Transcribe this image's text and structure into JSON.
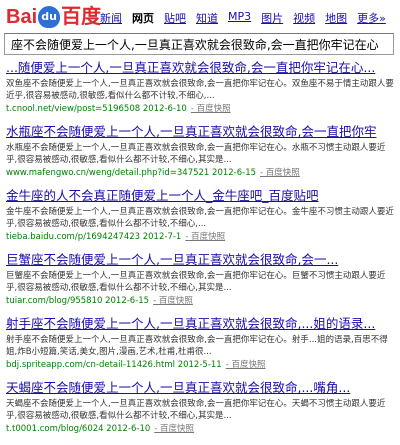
{
  "logo": {
    "text_left": "Bai",
    "paw": "du",
    "text_right": "百度"
  },
  "nav": [
    "新闻",
    "网页",
    "贴吧",
    "知道",
    "MP3",
    "图片",
    "视频",
    "地图",
    "更多»"
  ],
  "nav_active_index": 1,
  "search": {
    "value": "座不会随便爱上一个人,一旦真正喜欢就会很致命,会一直把你牢记在心"
  },
  "results": [
    {
      "title": "...随便爱上一个人,一旦真正喜欢就会很致命,会一直把你牢记在心...",
      "snippet": "双鱼座不会随便爱上一个人,一旦真正喜欢就会很致命,会一直把你牢记在心。双鱼座不易于情主动跟人要近乎,很容易被感动,很敏感,看似什么都不计较,不细心,...",
      "url": "t.cnool.net/view/post=5196508 2012-6-10",
      "snap": "- 百度快照"
    },
    {
      "title": "水瓶座不会随便爱上一个人,一旦真正喜欢就会很致命,会一直把你牢",
      "snippet": "水瓶座不会随便爱上一个人,一旦真正喜欢就会很致命,会一直把你牢记在心。水瓶不习惯主动跟人要近乎,很容易被感动,很敏感,看似什么都不计较,不细心,其实是...",
      "url": "www.mafengwo.cn/weng/detail.php?id=347521 2012-6-15",
      "snap": "- 百度快照"
    },
    {
      "title": "金牛座的人不会真正随便爱上一个人_金牛座吧_百度贴吧",
      "snippet": "金牛座不会随便爱上一个人,一旦真正喜欢就会很致命,会一直把你牢记在心。金牛座不习惯主动跟人要近乎,很容易被感动,很敏感,看似什么都不计较,不细心,...",
      "url": "tieba.baidu.com/p/1694247423 2012-7-1",
      "snap": "- 百度快照"
    },
    {
      "title": "巨蟹座不会随便爱上一个人,一旦真正喜欢就会很致命,会一...",
      "snippet": "巨蟹座不会随便爱上一个人,一旦真正喜欢就会很致命,会一直把你牢记在心。巨蟹不习惯主动跟人要近乎,很容易被感动,很敏感,看似什么都不计较,不细心,其实是...",
      "url": "tuiar.com/blog/955810 2012-6-15",
      "snap": "- 百度快照"
    },
    {
      "title": "射手座不会随便爱上一个人,一旦真正喜欢就会很致命,...姐的语录...",
      "snippet": "射手座不会随便爱上一个人,一旦真正喜欢就会很致命,会一直把你牢记在心。射手...姐的语录,百思不得姐,炸B小短篇,笑话,美女,图片,漫画,艺术,杜甫,杜甫很...",
      "url": "bdj.spriteapp.com/cn-detail-11426.html 2012-5-11",
      "snap": "- 百度快照"
    },
    {
      "title": "天蝎座不会随便爱上一个人,一旦真正喜欢就会很致命,...嘴角...",
      "snippet": "天蝎座不会随便爱上一个人,一旦真正喜欢就会很致命,会一直把你牢记在心。天蝎不习惯主动跟人要近乎,很容易被感动,很敏感,看似什么都不计较,不细心,其实是...",
      "url": "t.t0001.com/blog/6024 2012-6-10",
      "snap": "- 百度快照"
    }
  ]
}
